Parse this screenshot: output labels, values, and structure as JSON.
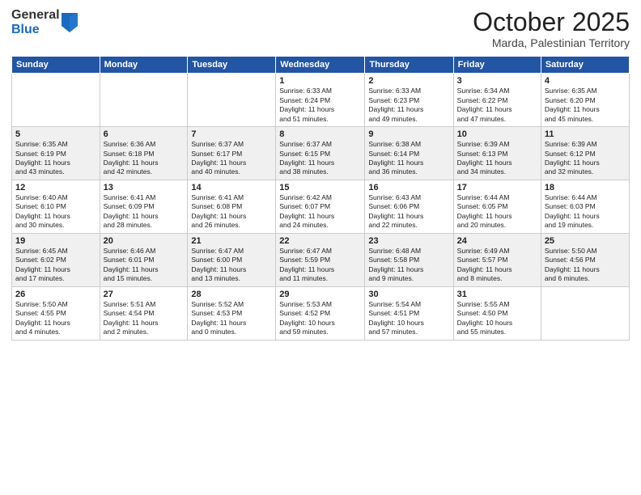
{
  "logo": {
    "general": "General",
    "blue": "Blue"
  },
  "header": {
    "month": "October 2025",
    "location": "Marda, Palestinian Territory"
  },
  "days_of_week": [
    "Sunday",
    "Monday",
    "Tuesday",
    "Wednesday",
    "Thursday",
    "Friday",
    "Saturday"
  ],
  "weeks": [
    [
      {
        "day": "",
        "info": ""
      },
      {
        "day": "",
        "info": ""
      },
      {
        "day": "",
        "info": ""
      },
      {
        "day": "1",
        "info": "Sunrise: 6:33 AM\nSunset: 6:24 PM\nDaylight: 11 hours\nand 51 minutes."
      },
      {
        "day": "2",
        "info": "Sunrise: 6:33 AM\nSunset: 6:23 PM\nDaylight: 11 hours\nand 49 minutes."
      },
      {
        "day": "3",
        "info": "Sunrise: 6:34 AM\nSunset: 6:22 PM\nDaylight: 11 hours\nand 47 minutes."
      },
      {
        "day": "4",
        "info": "Sunrise: 6:35 AM\nSunset: 6:20 PM\nDaylight: 11 hours\nand 45 minutes."
      }
    ],
    [
      {
        "day": "5",
        "info": "Sunrise: 6:35 AM\nSunset: 6:19 PM\nDaylight: 11 hours\nand 43 minutes."
      },
      {
        "day": "6",
        "info": "Sunrise: 6:36 AM\nSunset: 6:18 PM\nDaylight: 11 hours\nand 42 minutes."
      },
      {
        "day": "7",
        "info": "Sunrise: 6:37 AM\nSunset: 6:17 PM\nDaylight: 11 hours\nand 40 minutes."
      },
      {
        "day": "8",
        "info": "Sunrise: 6:37 AM\nSunset: 6:15 PM\nDaylight: 11 hours\nand 38 minutes."
      },
      {
        "day": "9",
        "info": "Sunrise: 6:38 AM\nSunset: 6:14 PM\nDaylight: 11 hours\nand 36 minutes."
      },
      {
        "day": "10",
        "info": "Sunrise: 6:39 AM\nSunset: 6:13 PM\nDaylight: 11 hours\nand 34 minutes."
      },
      {
        "day": "11",
        "info": "Sunrise: 6:39 AM\nSunset: 6:12 PM\nDaylight: 11 hours\nand 32 minutes."
      }
    ],
    [
      {
        "day": "12",
        "info": "Sunrise: 6:40 AM\nSunset: 6:10 PM\nDaylight: 11 hours\nand 30 minutes."
      },
      {
        "day": "13",
        "info": "Sunrise: 6:41 AM\nSunset: 6:09 PM\nDaylight: 11 hours\nand 28 minutes."
      },
      {
        "day": "14",
        "info": "Sunrise: 6:41 AM\nSunset: 6:08 PM\nDaylight: 11 hours\nand 26 minutes."
      },
      {
        "day": "15",
        "info": "Sunrise: 6:42 AM\nSunset: 6:07 PM\nDaylight: 11 hours\nand 24 minutes."
      },
      {
        "day": "16",
        "info": "Sunrise: 6:43 AM\nSunset: 6:06 PM\nDaylight: 11 hours\nand 22 minutes."
      },
      {
        "day": "17",
        "info": "Sunrise: 6:44 AM\nSunset: 6:05 PM\nDaylight: 11 hours\nand 20 minutes."
      },
      {
        "day": "18",
        "info": "Sunrise: 6:44 AM\nSunset: 6:03 PM\nDaylight: 11 hours\nand 19 minutes."
      }
    ],
    [
      {
        "day": "19",
        "info": "Sunrise: 6:45 AM\nSunset: 6:02 PM\nDaylight: 11 hours\nand 17 minutes."
      },
      {
        "day": "20",
        "info": "Sunrise: 6:46 AM\nSunset: 6:01 PM\nDaylight: 11 hours\nand 15 minutes."
      },
      {
        "day": "21",
        "info": "Sunrise: 6:47 AM\nSunset: 6:00 PM\nDaylight: 11 hours\nand 13 minutes."
      },
      {
        "day": "22",
        "info": "Sunrise: 6:47 AM\nSunset: 5:59 PM\nDaylight: 11 hours\nand 11 minutes."
      },
      {
        "day": "23",
        "info": "Sunrise: 6:48 AM\nSunset: 5:58 PM\nDaylight: 11 hours\nand 9 minutes."
      },
      {
        "day": "24",
        "info": "Sunrise: 6:49 AM\nSunset: 5:57 PM\nDaylight: 11 hours\nand 8 minutes."
      },
      {
        "day": "25",
        "info": "Sunrise: 5:50 AM\nSunset: 4:56 PM\nDaylight: 11 hours\nand 6 minutes."
      }
    ],
    [
      {
        "day": "26",
        "info": "Sunrise: 5:50 AM\nSunset: 4:55 PM\nDaylight: 11 hours\nand 4 minutes."
      },
      {
        "day": "27",
        "info": "Sunrise: 5:51 AM\nSunset: 4:54 PM\nDaylight: 11 hours\nand 2 minutes."
      },
      {
        "day": "28",
        "info": "Sunrise: 5:52 AM\nSunset: 4:53 PM\nDaylight: 11 hours\nand 0 minutes."
      },
      {
        "day": "29",
        "info": "Sunrise: 5:53 AM\nSunset: 4:52 PM\nDaylight: 10 hours\nand 59 minutes."
      },
      {
        "day": "30",
        "info": "Sunrise: 5:54 AM\nSunset: 4:51 PM\nDaylight: 10 hours\nand 57 minutes."
      },
      {
        "day": "31",
        "info": "Sunrise: 5:55 AM\nSunset: 4:50 PM\nDaylight: 10 hours\nand 55 minutes."
      },
      {
        "day": "",
        "info": ""
      }
    ]
  ]
}
